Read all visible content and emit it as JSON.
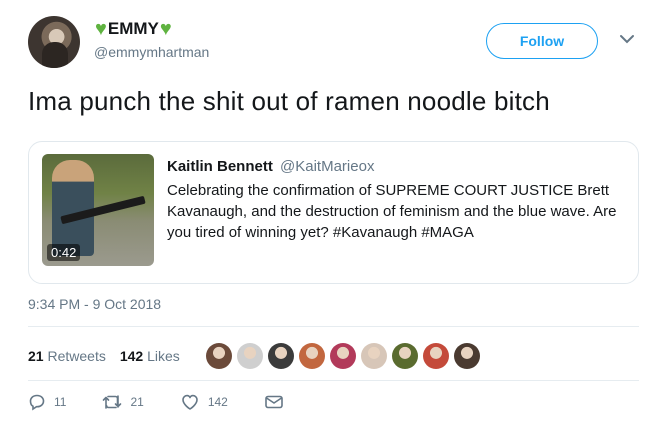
{
  "user": {
    "display_name": "EMMY",
    "handle": "@emmymhartman",
    "follow_label": "Follow"
  },
  "tweet": {
    "text": "Ima punch the shit out of ramen noodle bitch",
    "timestamp": "9:34 PM - 9 Oct 2018"
  },
  "quote": {
    "author_name": "Kaitlin Bennett",
    "author_handle": "@KaitMarieox",
    "text": "Celebrating the confirmation of SUPREME COURT JUSTICE Brett Kavanaugh, and the destruction of feminism and the blue wave. Are you tired of winning yet? #Kavanaugh #MAGA",
    "video_duration": "0:42"
  },
  "stats": {
    "retweets_count": "21",
    "retweets_label": "Retweets",
    "likes_count": "142",
    "likes_label": "Likes"
  },
  "likers": [
    {
      "color": "#6b4a3a"
    },
    {
      "color": "#cfcfcf"
    },
    {
      "color": "#3b3b3b"
    },
    {
      "color": "#c2673f"
    },
    {
      "color": "#b23a5a"
    },
    {
      "color": "#d7c6b8"
    },
    {
      "color": "#5a6b2f"
    },
    {
      "color": "#c44a3a"
    },
    {
      "color": "#4a3a30"
    }
  ],
  "actions": {
    "reply_count": "11",
    "retweet_count": "21",
    "like_count": "142"
  },
  "icons": [
    "green-heart-icon",
    "chevron-down-icon",
    "reply-icon",
    "retweet-icon",
    "like-icon",
    "message-icon"
  ],
  "colors": {
    "accent": "#1da1f2",
    "heart": "#5fb340",
    "muted": "#657786"
  }
}
